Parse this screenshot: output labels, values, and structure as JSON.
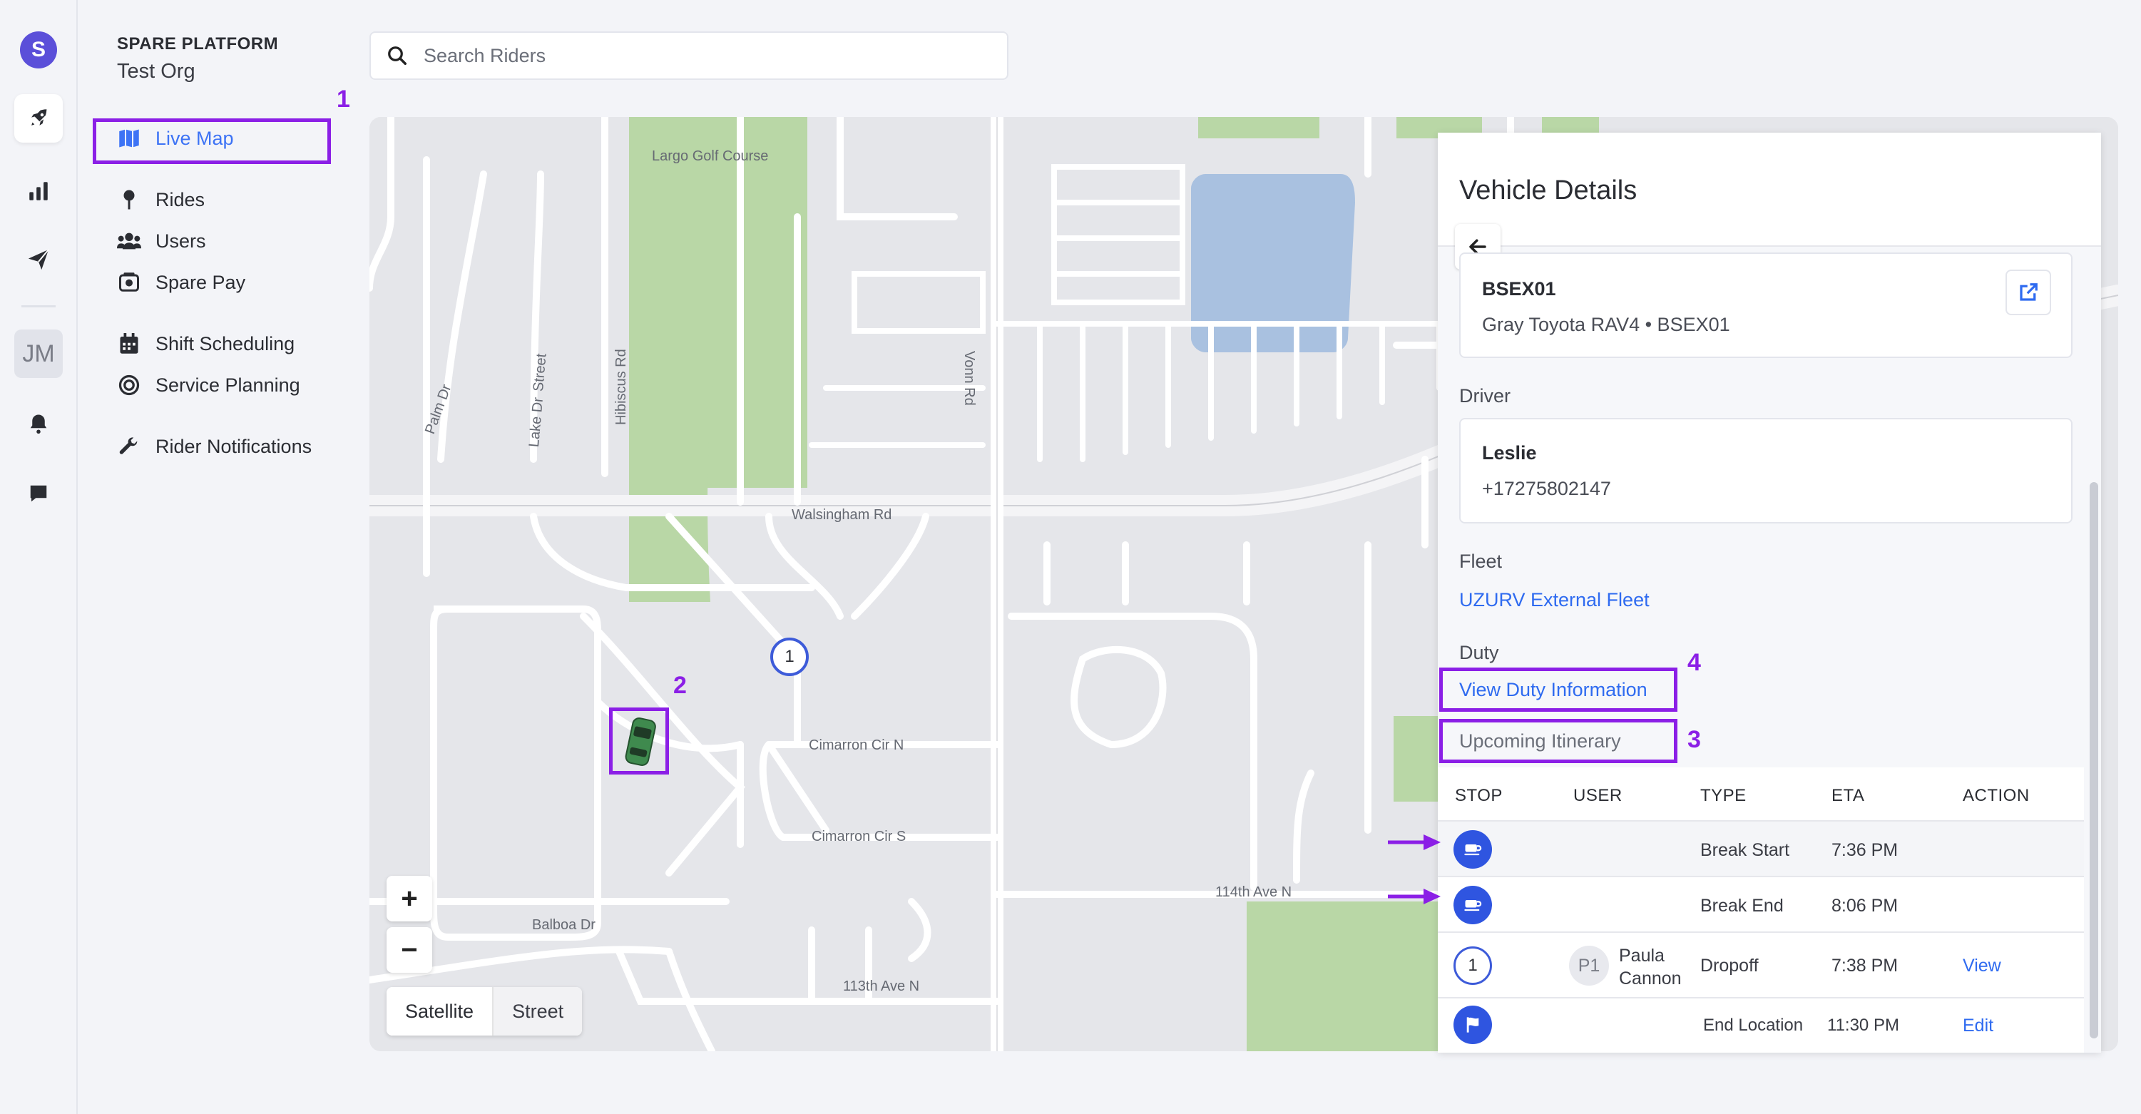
{
  "rail": {
    "logo_letter": "S",
    "avatar_initials": "JM",
    "icons": [
      "rocket-icon",
      "bar-chart-icon",
      "paper-plane-icon",
      "bell-icon",
      "chat-icon"
    ]
  },
  "sidebar": {
    "platform": "SPARE PLATFORM",
    "org": "Test Org",
    "items": [
      {
        "label": "Live Map",
        "icon": "map-icon",
        "active": true
      },
      {
        "label": "Rides",
        "icon": "pin-icon"
      },
      {
        "label": "Users",
        "icon": "users-icon"
      },
      {
        "label": "Spare Pay",
        "icon": "wallet-icon"
      },
      {
        "label": "Shift Scheduling",
        "icon": "calendar-icon"
      },
      {
        "label": "Service Planning",
        "icon": "target-icon"
      },
      {
        "label": "Rider Notifications",
        "icon": "wrench-icon"
      }
    ]
  },
  "search": {
    "placeholder": "Search Riders"
  },
  "annotations": {
    "a1": "1",
    "a2": "2",
    "a3": "3",
    "a4": "4"
  },
  "map": {
    "labels": {
      "golf": "Largo Golf Course",
      "walsingham": "Walsingham Rd",
      "vonn": "Vonn Rd",
      "palm": "Palm Dr",
      "lake": "Lake Dr",
      "street": "Street",
      "hibiscus": "Hibiscus Rd",
      "cimarron_n": "Cimarron Cir N",
      "cimarron_s": "Cimarron Cir S",
      "ave114": "114th Ave N",
      "ave113": "113th Ave N",
      "balboa": "Balboa Dr"
    },
    "stop_marker": "1",
    "zoom_in": "+",
    "zoom_out": "−",
    "map_types": [
      "Satellite",
      "Street"
    ]
  },
  "panel": {
    "title": "Vehicle Details",
    "vehicle": {
      "id": "BSEX01",
      "desc": "Gray Toyota RAV4 • BSEX01"
    },
    "driver_label": "Driver",
    "driver": {
      "name": "Leslie",
      "phone": "+17275802147"
    },
    "fleet_label": "Fleet",
    "fleet": "UZURV External Fleet",
    "duty_label": "Duty",
    "duty_link": "View Duty Information",
    "itinerary_label": "Upcoming Itinerary",
    "columns": [
      "STOP",
      "USER",
      "TYPE",
      "ETA",
      "ACTION"
    ],
    "rows": [
      {
        "stop": "coffee-icon",
        "user": "",
        "type": "Break Start",
        "eta": "7:36 PM",
        "action": ""
      },
      {
        "stop": "coffee-icon",
        "user": "",
        "type": "Break End",
        "eta": "8:06 PM",
        "action": ""
      },
      {
        "stop": "1",
        "badge": "P1",
        "user": "Paula Cannon",
        "user_first": "Paula",
        "user_last": "Cannon",
        "type": "Dropoff",
        "eta": "7:38 PM",
        "action": "View"
      },
      {
        "stop": "flag-icon",
        "user": "",
        "type": "End Location",
        "eta": "11:30 PM",
        "action": "Edit"
      }
    ]
  },
  "colors": {
    "accent": "#3d73f5",
    "highlight": "#8b1fe6",
    "stop_fill": "#2f55e0",
    "park": "#b9d7a6",
    "water": "#a9c1e0"
  }
}
